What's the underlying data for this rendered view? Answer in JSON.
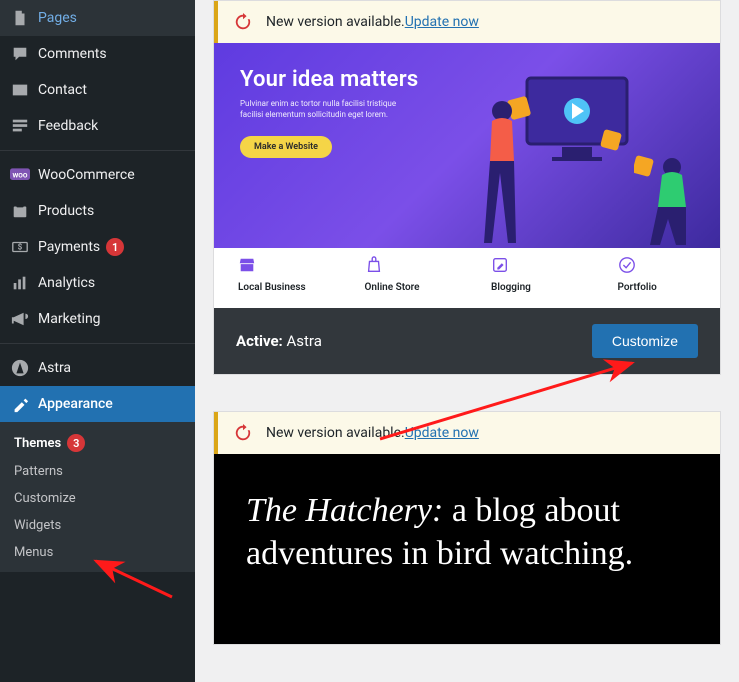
{
  "sidebar": {
    "items": [
      {
        "label": "Pages"
      },
      {
        "label": "Comments"
      },
      {
        "label": "Contact"
      },
      {
        "label": "Feedback"
      },
      {
        "label": "WooCommerce"
      },
      {
        "label": "Products"
      },
      {
        "label": "Payments",
        "badge": "1"
      },
      {
        "label": "Analytics"
      },
      {
        "label": "Marketing"
      },
      {
        "label": "Astra"
      },
      {
        "label": "Appearance"
      }
    ],
    "submenu": [
      {
        "label": "Themes",
        "badge": "3"
      },
      {
        "label": "Patterns"
      },
      {
        "label": "Customize"
      },
      {
        "label": "Widgets"
      },
      {
        "label": "Menus"
      }
    ]
  },
  "notice": {
    "text": "New version available. ",
    "link": "Update now"
  },
  "theme1": {
    "hero": {
      "title": "Your idea matters",
      "desc": "Pulvinar enim ac tortor nulla facilisi tristique facilisi elementum sollicitudin eget lorem.",
      "cta": "Make a Website"
    },
    "cats": [
      {
        "label": "Local Business"
      },
      {
        "label": "Online Store"
      },
      {
        "label": "Blogging"
      },
      {
        "label": "Portfolio"
      }
    ],
    "footer": {
      "activeLabel": "Active:",
      "name": "Astra",
      "button": "Customize"
    }
  },
  "theme2": {
    "titleEm": "The Hatchery:",
    "titleRest": " a blog about adventures in bird watching."
  }
}
